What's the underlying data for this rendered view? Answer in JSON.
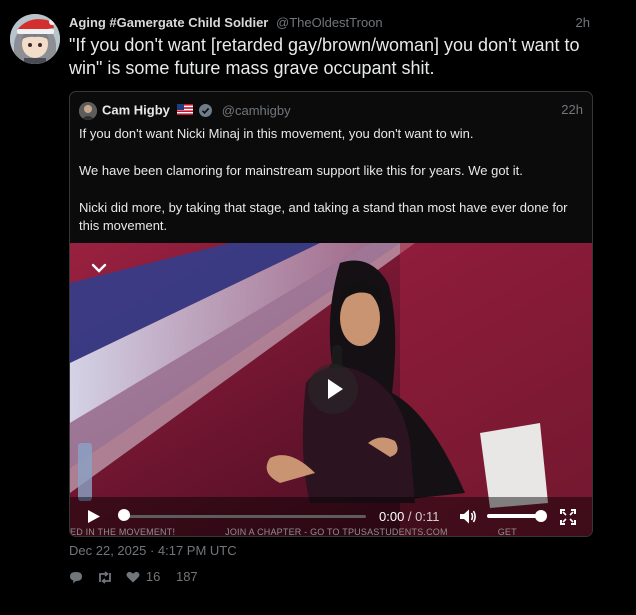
{
  "post": {
    "author": "Aging #Gamergate Child Soldier",
    "handle": "@TheOldestTroon",
    "time": "2h",
    "text": "\"If you don't want [retarded gay/brown/woman] you don't want to win\" is some future mass grave occupant shit.",
    "date": "Dec 22, 2025 · 4:17 PM UTC",
    "likes": "16",
    "views": "187"
  },
  "quote": {
    "author": "Cam Higby",
    "handle": "@camhigby",
    "time": "22h",
    "paragraphs": [
      "If you don't want Nicki Minaj in this movement, you don't want to win.",
      "We have been clamoring for mainstream support like this for years. We got it.",
      "Nicki did more, by taking that stage, and taking a stand than most have ever done for this movement."
    ]
  },
  "video": {
    "current_time": "0:00",
    "separator": " / ",
    "duration": "0:11",
    "progress": 0,
    "volume": 1.0,
    "ticker": [
      "ED IN THE MOVEMENT!",
      "JOIN A CHAPTER - GO TO TPUSASTUDENTS.COM",
      "GET"
    ]
  },
  "colors": {
    "background": "#000000",
    "text": "#e7e9ea",
    "muted": "#71767b",
    "border": "#343638"
  }
}
